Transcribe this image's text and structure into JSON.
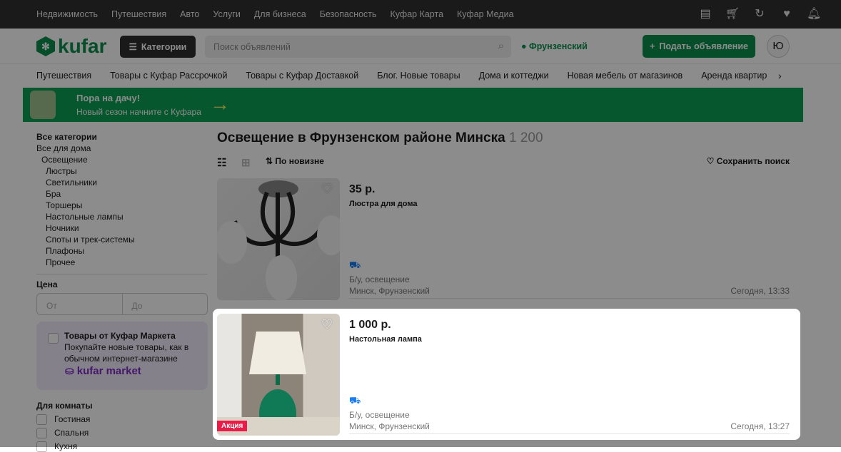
{
  "topbar": {
    "links": [
      "Недвижимость",
      "Путешествия",
      "Авто",
      "Услуги",
      "Для бизнеса",
      "Безопасность",
      "Куфар Карта",
      "Куфар Медиа"
    ]
  },
  "header": {
    "logo": "kufar",
    "categories": "Категории",
    "search_placeholder": "Поиск объявлений",
    "location": "Фрунзенский",
    "post": "Подать объявление",
    "avatar": "Ю"
  },
  "links": [
    "Путешествия",
    "Товары с Куфар Рассрочкой",
    "Товары с Куфар Доставкой",
    "Блог. Новые товары",
    "Дома и коттеджи",
    "Новая мебель от магазинов",
    "Аренда квартир"
  ],
  "banner": {
    "title": "Пора на дачу!",
    "subtitle": "Новый сезон начните с Куфара"
  },
  "sidebar": {
    "all": "Все категории",
    "home": "Все для дома",
    "lighting": "Освещение",
    "subs": [
      "Люстры",
      "Светильники",
      "Бра",
      "Торшеры",
      "Настольные лампы",
      "Ночники",
      "Споты и трек-системы",
      "Плафоны",
      "Прочее"
    ],
    "price_label": "Цена",
    "price_from": "От",
    "price_to": "До",
    "market_title": "Товары от Куфар Маркета",
    "market_text": "Покупайте новые товары, как в обычном интернет-магазине",
    "market_logo": "kufar market",
    "room_label": "Для комнаты",
    "rooms": [
      "Гостиная",
      "Спальня",
      "Кухня"
    ]
  },
  "main": {
    "title": "Освещение в Фрунзенском районе Минска",
    "count": "1 200",
    "sort": "По новизне",
    "save_search": "Сохранить поиск",
    "listings": [
      {
        "price": "35 р.",
        "title": "Люстра для дома",
        "condition": "Б/у, освещение",
        "location": "Минск, Фрунзенский",
        "time": "Сегодня, 13:33"
      },
      {
        "price": "1 000 р.",
        "title": "Настольная лампа",
        "condition": "Б/у, освещение",
        "location": "Минск, Фрунзенский",
        "time": "Сегодня, 13:27",
        "badge": "Акция"
      }
    ]
  }
}
